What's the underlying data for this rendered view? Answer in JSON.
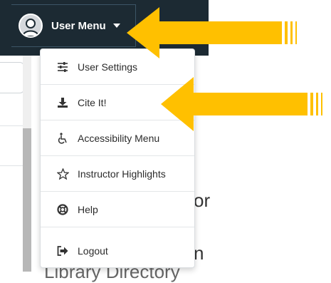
{
  "topbar": {
    "user_menu_label": "User Menu"
  },
  "menu": {
    "items": [
      {
        "label": "User Settings",
        "icon": "sliders-icon"
      },
      {
        "label": "Cite It!",
        "icon": "download-icon"
      },
      {
        "label": "Accessibility Menu",
        "icon": "wheelchair-icon"
      },
      {
        "label": "Instructor Highlights",
        "icon": "star-icon"
      },
      {
        "label": "Help",
        "icon": "lifebuoy-icon"
      },
      {
        "label": "Logout",
        "icon": "sign-out-icon"
      }
    ]
  },
  "background": {
    "partial_text_1": "or",
    "partial_text_2": "n",
    "partial_text_3": "Library Directory"
  },
  "colors": {
    "topbar": "#1c2a33",
    "arrow": "#ffc000",
    "dropdown_border": "#d9dde0"
  }
}
